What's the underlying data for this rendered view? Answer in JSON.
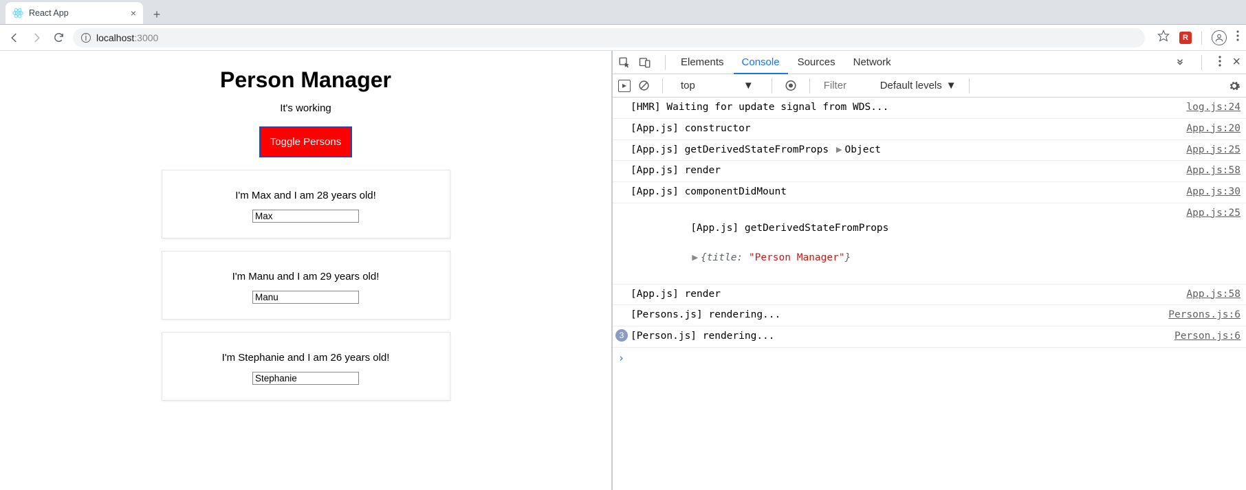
{
  "browser": {
    "tab_title": "React App",
    "url_host": "localhost",
    "url_port": ":3000"
  },
  "app": {
    "title": "Person Manager",
    "subtitle": "It's working",
    "toggle_label": "Toggle Persons",
    "persons": [
      {
        "sentence": "I'm Max and I am 28 years old!",
        "value": "Max"
      },
      {
        "sentence": "I'm Manu and I am 29 years old!",
        "value": "Manu"
      },
      {
        "sentence": "I'm Stephanie and I am 26 years old!",
        "value": "Stephanie"
      }
    ]
  },
  "devtools": {
    "tabs": {
      "elements": "Elements",
      "console": "Console",
      "sources": "Sources",
      "network": "Network"
    },
    "context": "top",
    "filter_placeholder": "Filter",
    "levels": "Default levels",
    "logs": [
      {
        "msg": "[HMR] Waiting for update signal from WDS...",
        "src": "log.js:24"
      },
      {
        "msg": "[App.js] constructor",
        "src": "App.js:20"
      },
      {
        "msg": "[App.js] getDerivedStateFromProps ",
        "expand_obj": "Object",
        "src": "App.js:25"
      },
      {
        "msg": "[App.js] render",
        "src": "App.js:58"
      },
      {
        "msg": "[App.js] componentDidMount",
        "src": "App.js:30"
      },
      {
        "msg": "[App.js] getDerivedStateFromProps",
        "obj_preview_key": "{title: ",
        "obj_preview_val": "\"Person Manager\"",
        "obj_preview_tail": "}",
        "src": "App.js:25"
      },
      {
        "msg": "[App.js] render",
        "src": "App.js:58"
      },
      {
        "msg": "[Persons.js] rendering...",
        "src": "Persons.js:6"
      },
      {
        "msg": "[Person.js] rendering...",
        "src": "Person.js:6",
        "count": "3"
      }
    ]
  }
}
